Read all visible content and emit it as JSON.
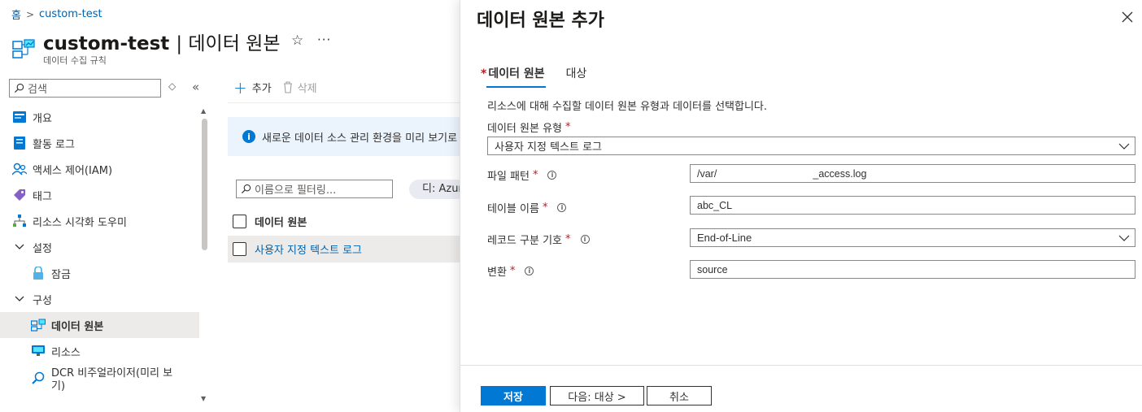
{
  "breadcrumb": {
    "home": "홈",
    "current": "custom-test"
  },
  "header": {
    "title_name": "custom-test",
    "title_section": "| 데이터 원본",
    "subtitle": "데이터 수집 규칙",
    "more": "···"
  },
  "sidebar": {
    "search_placeholder": "검색",
    "items": [
      {
        "label": "개요",
        "icon": "overview-icon"
      },
      {
        "label": "활동 로그",
        "icon": "activity-log-icon"
      },
      {
        "label": "액세스 제어(IAM)",
        "icon": "iam-icon"
      },
      {
        "label": "태그",
        "icon": "tag-icon"
      },
      {
        "label": "리소스 시각화 도우미",
        "icon": "resource-visualizer-icon"
      },
      {
        "label": "설정",
        "icon": "chevron-down-icon"
      },
      {
        "label": "잠금",
        "icon": "lock-icon"
      },
      {
        "label": "구성",
        "icon": "chevron-down-icon"
      },
      {
        "label": "데이터 원본",
        "icon": "data-source-icon"
      },
      {
        "label": "리소스",
        "icon": "resources-icon"
      },
      {
        "label": "DCR 비주얼라이저(미리 보기)",
        "icon": "visualizer-icon"
      }
    ]
  },
  "toolbar": {
    "add_label": "추가",
    "delete_label": "삭제"
  },
  "info_bar": {
    "text": "새로운 데이터 소스 관리 환경을 미리 보기로"
  },
  "list": {
    "filter_placeholder": "이름으로 필터링...",
    "pill_text": "디: Azure",
    "column_header": "데이터 원본",
    "rows": [
      "사용자 지정 텍스트 로그"
    ]
  },
  "panel": {
    "title": "데이터 원본 추가",
    "tabs": [
      {
        "label": "데이터 원본",
        "required": "*"
      },
      {
        "label": "대상"
      }
    ],
    "description": "리소스에 대해 수집할 데이터 원본 유형과 데이터를 선택합니다.",
    "data_source_type": {
      "label": "데이터 원본 유형",
      "required": "*",
      "value": "사용자 지정 텍스트 로그"
    },
    "file_pattern": {
      "label": "파일 패턴",
      "required": "*",
      "value": "/var/                                  _access.log"
    },
    "table_name": {
      "label": "테이블 이름",
      "required": "*",
      "value": "abc_CL"
    },
    "record_delimiter": {
      "label": "레코드 구분 기호",
      "required": "*",
      "value": "End-of-Line"
    },
    "transform": {
      "label": "변환",
      "required": "*",
      "value": "source"
    },
    "buttons": {
      "save": "저장",
      "next": "다음: 대상 >",
      "cancel": "취소"
    }
  },
  "colors": {
    "accent": "#0078d4",
    "link": "#0062ad",
    "required": "#a4262c",
    "info_bg": "#ebf3fc",
    "active_nav": "#edebe9"
  }
}
